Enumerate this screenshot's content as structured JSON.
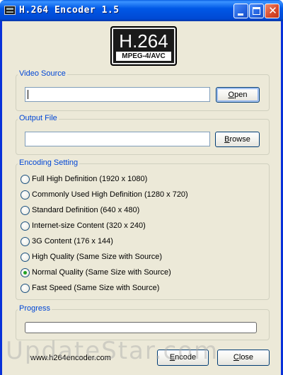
{
  "window": {
    "title": "H.264 Encoder 1.5",
    "icon": "app-icon",
    "controls": {
      "minimize_icon": "minimize-icon",
      "maximize_icon": "maximize-icon",
      "close_icon": "close-icon",
      "close_glyph": "✕"
    }
  },
  "logo": {
    "main": "H.264",
    "sub": "MPEG-4/AVC"
  },
  "video_source": {
    "label": "Video Source",
    "value": "",
    "button": {
      "underlined": "O",
      "rest": "pen"
    }
  },
  "output_file": {
    "label": "Output File",
    "value": "",
    "button": {
      "underlined": "B",
      "rest": "rowse"
    }
  },
  "encoding": {
    "label": "Encoding Setting",
    "options": [
      {
        "label": "Full High Definition (1920 x 1080)",
        "selected": false
      },
      {
        "label": "Commonly Used High Definition (1280 x 720)",
        "selected": false
      },
      {
        "label": "Standard Definition (640 x 480)",
        "selected": false
      },
      {
        "label": "Internet-size Content (320 x 240)",
        "selected": false
      },
      {
        "label": "3G Content (176 x 144)",
        "selected": false
      },
      {
        "label": "High Quality (Same Size with Source)",
        "selected": false
      },
      {
        "label": "Normal Quality (Same Size with Source)",
        "selected": true
      },
      {
        "label": "Fast Speed (Same Size with Source)",
        "selected": false
      }
    ]
  },
  "progress": {
    "label": "Progress",
    "value": 0
  },
  "footer": {
    "url": "www.h264encoder.com",
    "encode_button": {
      "underlined": "E",
      "rest": "ncode"
    },
    "close_button": {
      "underlined": "C",
      "rest": "lose"
    }
  },
  "watermark": "UpdateStar.com",
  "colors": {
    "titlebar": "#0058e6",
    "group_label": "#0046d5",
    "radio_selected": "#21a121",
    "dialog_background": "#ece9d8"
  }
}
